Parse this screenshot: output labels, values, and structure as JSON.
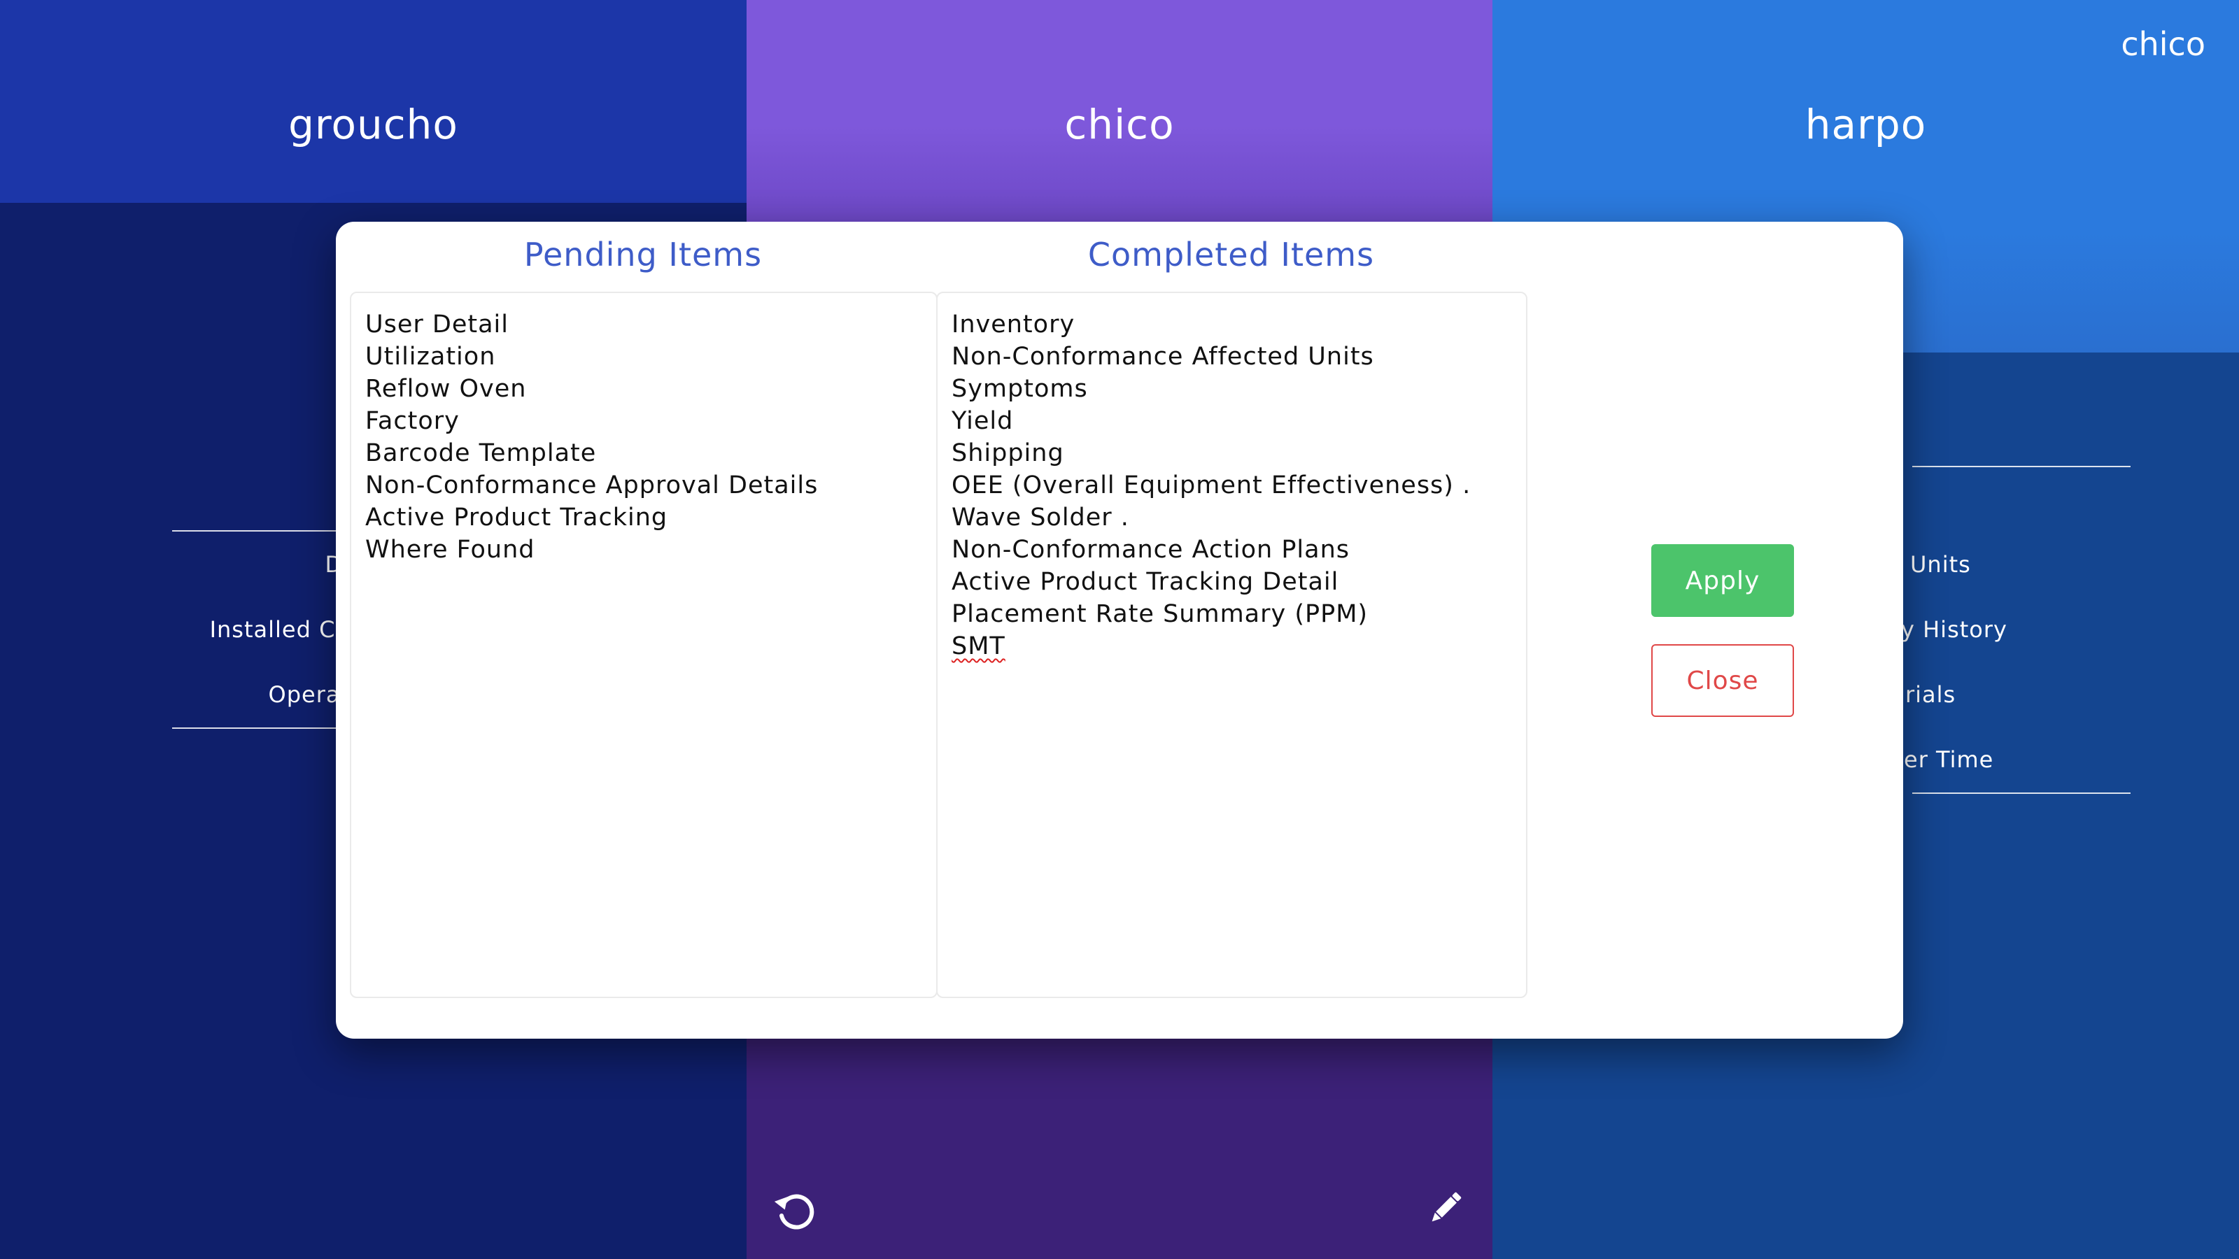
{
  "columns": {
    "left": {
      "title": "groucho"
    },
    "middle": {
      "title": "chico"
    },
    "right": {
      "title": "harpo"
    }
  },
  "current_user": "chico",
  "left_menu": {
    "items": [
      "Di",
      "Installed Co",
      "Operat"
    ]
  },
  "right_menu": {
    "items": [
      "Units",
      "y History",
      "rials",
      "er Time"
    ]
  },
  "icons": {
    "bottom_left": "refresh-icon",
    "bottom_right": "pencil-icon"
  },
  "modal": {
    "pending_title": "Pending Items",
    "completed_title": "Completed Items",
    "pending_items": [
      "User Detail",
      "Utilization",
      "Reflow Oven",
      "Factory",
      "Barcode Template",
      "Non-Conformance Approval Details",
      "Active Product Tracking",
      "Where Found"
    ],
    "completed_items": [
      "Inventory",
      "Non-Conformance Affected Units",
      "Symptoms",
      "Yield",
      "Shipping",
      "OEE (Overall Equipment Effectiveness) .",
      "Wave Solder .",
      "Non-Conformance Action Plans",
      "Active Product Tracking Detail",
      "Placement Rate Summary (PPM)",
      "SMT"
    ],
    "apply_label": "Apply",
    "close_label": "Close"
  },
  "colors": {
    "apply": "#4cc46b",
    "close": "#e04848",
    "title": "#3e5cc8"
  }
}
